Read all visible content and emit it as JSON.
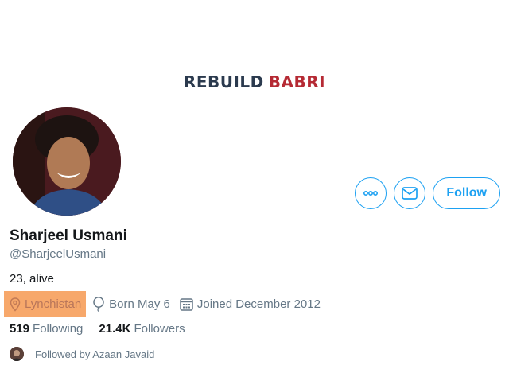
{
  "banner": {
    "word1": "REBUILD",
    "word2": "BABRI"
  },
  "profile": {
    "name": "Sharjeel Usmani",
    "handle": "@SharjeelUsmani",
    "bio": "23, alive",
    "location": "Lynchistan",
    "birthday": "Born May 6",
    "joined": "Joined December 2012"
  },
  "actions": {
    "follow_label": "Follow"
  },
  "stats": {
    "following_count": "519",
    "following_label": "Following",
    "followers_count": "21.4K",
    "followers_label": "Followers"
  },
  "followed_by": "Followed by Azaan Javaid",
  "colors": {
    "accent": "#1da1f2",
    "highlight": "#f7a86b",
    "banner_red": "#b52a34",
    "banner_dark": "#2b3a4e"
  },
  "icons": [
    "more-icon",
    "envelope-icon",
    "location-pin-icon",
    "balloon-icon",
    "calendar-icon"
  ]
}
